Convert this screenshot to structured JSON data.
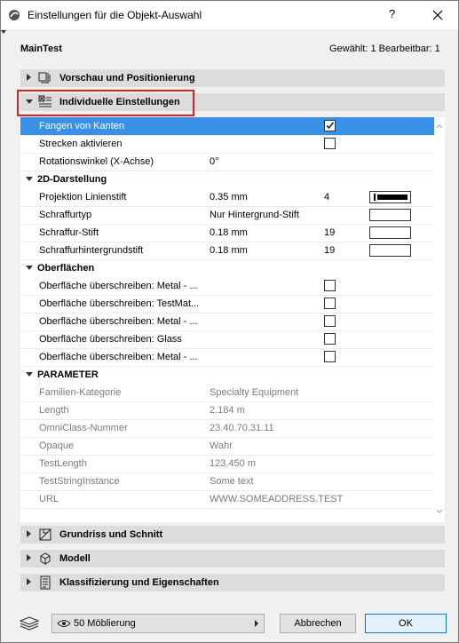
{
  "window": {
    "title": "Einstellungen für die Objekt-Auswahl",
    "help_label": "?"
  },
  "header": {
    "name": "MainTest",
    "selection_info": "Gewählt: 1 Bearbeitbar: 1"
  },
  "sections": {
    "preview": "Vorschau und Positionierung",
    "individual": "Individuelle Einstellungen",
    "floorplan": "Grundriss und Schnitt",
    "model": "Modell",
    "classification": "Klassifizierung und Eigenschaften"
  },
  "rows_top": [
    {
      "label": "Fangen von Kanten",
      "checked": true
    },
    {
      "label": "Strecken aktivieren",
      "checked": false
    },
    {
      "label": "Rotationswinkel (X-Achse)",
      "value": "0°"
    }
  ],
  "groups": {
    "darstellung": "2D-Darstellung",
    "oberflaechen": "Oberflächen",
    "parameter": "PARAMETER"
  },
  "darstellung_rows": [
    {
      "label": "Projektion Linienstift",
      "value": "0.35 mm",
      "pen": "4"
    },
    {
      "label": "Schraffurtyp",
      "value": "Nur Hintergrund-Stift",
      "pen": ""
    },
    {
      "label": "Schraffur-Stift",
      "value": "0.18 mm",
      "pen": "19"
    },
    {
      "label": "Schraffurhintergrundstift",
      "value": "0.18 mm",
      "pen": "19"
    }
  ],
  "oberflaechen_rows": [
    {
      "label": "Oberfläche überschreiben: Metal - ..."
    },
    {
      "label": "Oberfläche überschreiben: TestMat..."
    },
    {
      "label": "Oberfläche überschreiben: Metal - ..."
    },
    {
      "label": "Oberfläche überschreiben: Glass"
    },
    {
      "label": "Oberfläche überschreiben: Metal - ..."
    }
  ],
  "parameter_rows": [
    {
      "label": "Familien-Kategorie",
      "value": "Specialty Equipment"
    },
    {
      "label": "Length",
      "value": "2.184 m"
    },
    {
      "label": "OmniClass-Nummer",
      "value": "23.40.70.31.11"
    },
    {
      "label": "Opaque",
      "value": "Wahr"
    },
    {
      "label": "TestLength",
      "value": "123.450 m"
    },
    {
      "label": "TestStringInstance",
      "value": "Some text"
    },
    {
      "label": "URL",
      "value": "WWW.SOMEADDRESS.TEST"
    }
  ],
  "footer": {
    "layer": "50 Möblierung",
    "cancel": "Abbrechen",
    "ok": "OK"
  },
  "colors": {
    "selection": "#3a8fe6",
    "highlight_border": "#e02020",
    "ok_border": "#0078d7"
  }
}
